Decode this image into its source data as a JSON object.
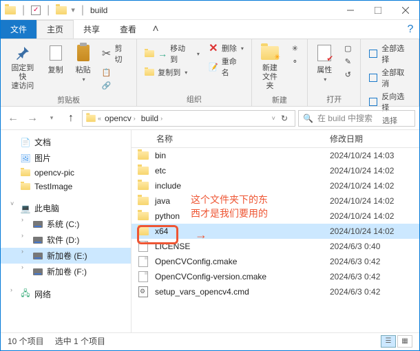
{
  "titlebar": {
    "title": "build"
  },
  "tabs": {
    "file": "文件",
    "home": "主页",
    "share": "共享",
    "view": "查看"
  },
  "ribbon": {
    "pin": "固定到快\n速访问",
    "copy": "复制",
    "paste": "粘贴",
    "cut": "剪切",
    "clipboard_group": "剪贴板",
    "moveto": "移动到",
    "copyto": "复制到",
    "delete": "删除",
    "rename": "重命名",
    "organize_group": "组织",
    "newfolder": "新建\n文件夹",
    "new_group": "新建",
    "properties": "属性",
    "open_group": "打开",
    "select_all": "全部选择",
    "select_none": "全部取消",
    "invert": "反向选择",
    "select_group": "选择"
  },
  "address": {
    "crumbs": [
      "opencv",
      "build"
    ],
    "search_placeholder": "在 build 中搜索"
  },
  "sidebar": {
    "items": [
      {
        "label": "文档",
        "icon": "doc"
      },
      {
        "label": "图片",
        "icon": "pic"
      },
      {
        "label": "opencv-pic",
        "icon": "fold"
      },
      {
        "label": "TestImage",
        "icon": "fold"
      }
    ],
    "pc": "此电脑",
    "drives": [
      {
        "label": "系统 (C:)"
      },
      {
        "label": "软件 (D:)"
      },
      {
        "label": "新加卷 (E:)",
        "selected": true
      },
      {
        "label": "新加卷 (F:)"
      }
    ],
    "network": "网络"
  },
  "columns": {
    "name": "名称",
    "modified": "修改日期"
  },
  "files": [
    {
      "name": "bin",
      "type": "folder",
      "date": "2024/10/24 14:03"
    },
    {
      "name": "etc",
      "type": "folder",
      "date": "2024/10/24 14:02"
    },
    {
      "name": "include",
      "type": "folder",
      "date": "2024/10/24 14:02"
    },
    {
      "name": "java",
      "type": "folder",
      "date": "2024/10/24 14:02"
    },
    {
      "name": "python",
      "type": "folder",
      "date": "2024/10/24 14:02"
    },
    {
      "name": "x64",
      "type": "folder",
      "date": "2024/10/24 14:02",
      "selected": true
    },
    {
      "name": "LICENSE",
      "type": "file",
      "date": "2024/6/3 0:40"
    },
    {
      "name": "OpenCVConfig.cmake",
      "type": "file",
      "date": "2024/6/3 0:42"
    },
    {
      "name": "OpenCVConfig-version.cmake",
      "type": "file",
      "date": "2024/6/3 0:42"
    },
    {
      "name": "setup_vars_opencv4.cmd",
      "type": "cmd",
      "date": "2024/6/3 0:42"
    }
  ],
  "annotation": {
    "line1": "这个文件夹下的东",
    "line2": "西才是我们要用的"
  },
  "status": {
    "count": "10 个项目",
    "selected": "选中 1 个项目"
  }
}
